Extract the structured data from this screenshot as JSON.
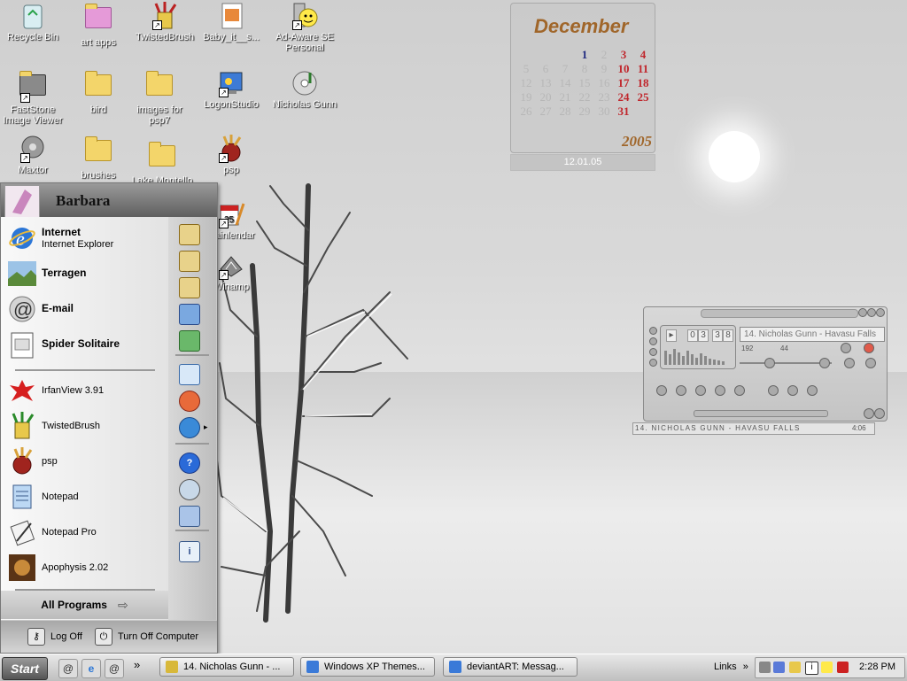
{
  "desktop": {
    "icons": [
      {
        "label": "Recycle Bin",
        "icon": "recycle-bin-icon"
      },
      {
        "label": "art apps",
        "icon": "folder-pink-icon"
      },
      {
        "label": "TwistedBrush",
        "icon": "twistedbrush-icon"
      },
      {
        "label": "Baby_it__s...",
        "icon": "document-icon"
      },
      {
        "label": "Ad-Aware SE Personal",
        "icon": "ad-aware-icon"
      },
      {
        "label": "FastStone Image Viewer",
        "icon": "faststone-icon"
      },
      {
        "label": "bird",
        "icon": "folder-icon"
      },
      {
        "label": "images for psp7",
        "icon": "folder-icon"
      },
      {
        "label": "LogonStudio",
        "icon": "logonstudio-icon"
      },
      {
        "label": "Nicholas Gunn",
        "icon": "music-cd-icon"
      },
      {
        "label": "Maxtor",
        "icon": "maxtor-icon"
      },
      {
        "label": "brushes",
        "icon": "folder-icon"
      },
      {
        "label": "Lake Montello",
        "icon": "folder-icon"
      },
      {
        "label": "psp",
        "icon": "psp-icon"
      },
      {
        "label": "Rainlendar",
        "icon": "rainlendar-icon"
      },
      {
        "label": "Winamp",
        "icon": "winamp-icon"
      }
    ]
  },
  "calendar": {
    "month": "December",
    "year": "2005",
    "date": "12.01.05",
    "weeks": [
      [
        "",
        "",
        "",
        "1",
        "2",
        "3",
        "4"
      ],
      [
        "5",
        "6",
        "7",
        "8",
        "9",
        "10",
        "11"
      ],
      [
        "12",
        "13",
        "14",
        "15",
        "16",
        "17",
        "18"
      ],
      [
        "19",
        "20",
        "21",
        "22",
        "23",
        "24",
        "25"
      ],
      [
        "26",
        "27",
        "28",
        "29",
        "30",
        "31",
        ""
      ]
    ]
  },
  "player": {
    "track_title": "14. Nicholas Gunn - Havasu Falls",
    "time_digits": [
      "0",
      "3",
      "3",
      "8"
    ],
    "kbps": "192",
    "khz": "44",
    "strip_text": "14. NICHOLAS GUNN - HAVASU FALLS",
    "strip_time": "4:06"
  },
  "start_menu": {
    "user": "Barbara",
    "pinned": [
      {
        "title": "Internet",
        "subtitle": "Internet Explorer",
        "icon": "internet-explorer-icon"
      },
      {
        "title": "Terragen",
        "subtitle": "",
        "icon": "terragen-icon"
      },
      {
        "title": "E-mail",
        "subtitle": "",
        "icon": "email-icon"
      },
      {
        "title": "Spider Solitaire",
        "subtitle": "",
        "icon": "spider-solitaire-icon"
      }
    ],
    "recent": [
      {
        "label": "IrfanView 3.91",
        "icon": "irfanview-icon"
      },
      {
        "label": "TwistedBrush",
        "icon": "twistedbrush-icon"
      },
      {
        "label": "psp",
        "icon": "psp-icon"
      },
      {
        "label": "Notepad",
        "icon": "notepad-icon"
      },
      {
        "label": "Notepad Pro",
        "icon": "notepad-pro-icon"
      },
      {
        "label": "Apophysis 2.02",
        "icon": "apophysis-icon"
      }
    ],
    "all_programs": "All Programs",
    "log_off": "Log Off",
    "turn_off": "Turn Off Computer",
    "right_icons": [
      "my-documents-icon",
      "my-pictures-icon",
      "my-music-icon",
      "my-computer-icon",
      "network-icon",
      "control-panel-icon",
      "printers-icon",
      "connect-to-icon",
      "help-icon",
      "search-icon",
      "run-icon",
      "info-icon"
    ]
  },
  "taskbar": {
    "start_label": "Start",
    "quick_launch": [
      "@",
      "e",
      "@"
    ],
    "more": "»",
    "buttons": [
      {
        "label": "14. Nicholas Gunn - ...",
        "icon": "winamp-icon"
      },
      {
        "label": "Windows XP Themes...",
        "icon": "browser-icon"
      },
      {
        "label": "deviantART: Messag...",
        "icon": "browser-icon"
      }
    ],
    "links": "Links",
    "clock": "2:28 PM",
    "colors": {
      "accent": "#c0262c",
      "brand": "#a0662a"
    }
  }
}
